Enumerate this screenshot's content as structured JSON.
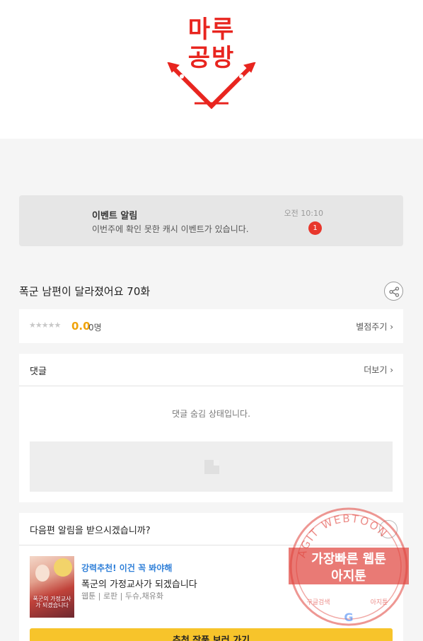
{
  "header": {
    "logo_text_1": "마루",
    "logo_text_2": "공방",
    "brand_color": "#e8251f"
  },
  "event": {
    "title": "이벤트 알림",
    "desc": "이번주에 확인 못한 캐시 이벤트가 있습니다.",
    "time": "오전 10:10",
    "badge": "1"
  },
  "episode": {
    "title": "폭군 남편이 달라졌어요 70화"
  },
  "rating": {
    "stars": "★★★★★",
    "score": "0.0",
    "count": "0명",
    "rate_label": "별점주기 ›"
  },
  "comments": {
    "title": "댓글",
    "more_label": "더보기 ›",
    "hidden_msg": "댓글 숨김 상태입니다."
  },
  "next_episode": {
    "question": "다음편 알림을 받으시겠습니까?",
    "recommend_tag": "강력추천! 이건 꼭 봐야해",
    "recommend_title": "폭군의 가정교사가 되겠습니다",
    "recommend_meta": "웹툰 | 로판 | 두슈,채유화",
    "thumb_caption": "폭군의 가정교사가 되겠습니다",
    "button_label": "추천 작품 보러 가기"
  },
  "watermark": {
    "arc_text": "AGIT WEBTOON",
    "line1": "가장빠른 웹툰",
    "line2": "아지툰",
    "bottom_left": "구글검색",
    "bottom_right": "아지툰",
    "color": "#e0413a"
  },
  "colors": {
    "accent_red": "#e8372c",
    "star_score": "#f0a30a",
    "link_blue": "#2f7fd8",
    "button_yellow": "#f7c42b"
  }
}
